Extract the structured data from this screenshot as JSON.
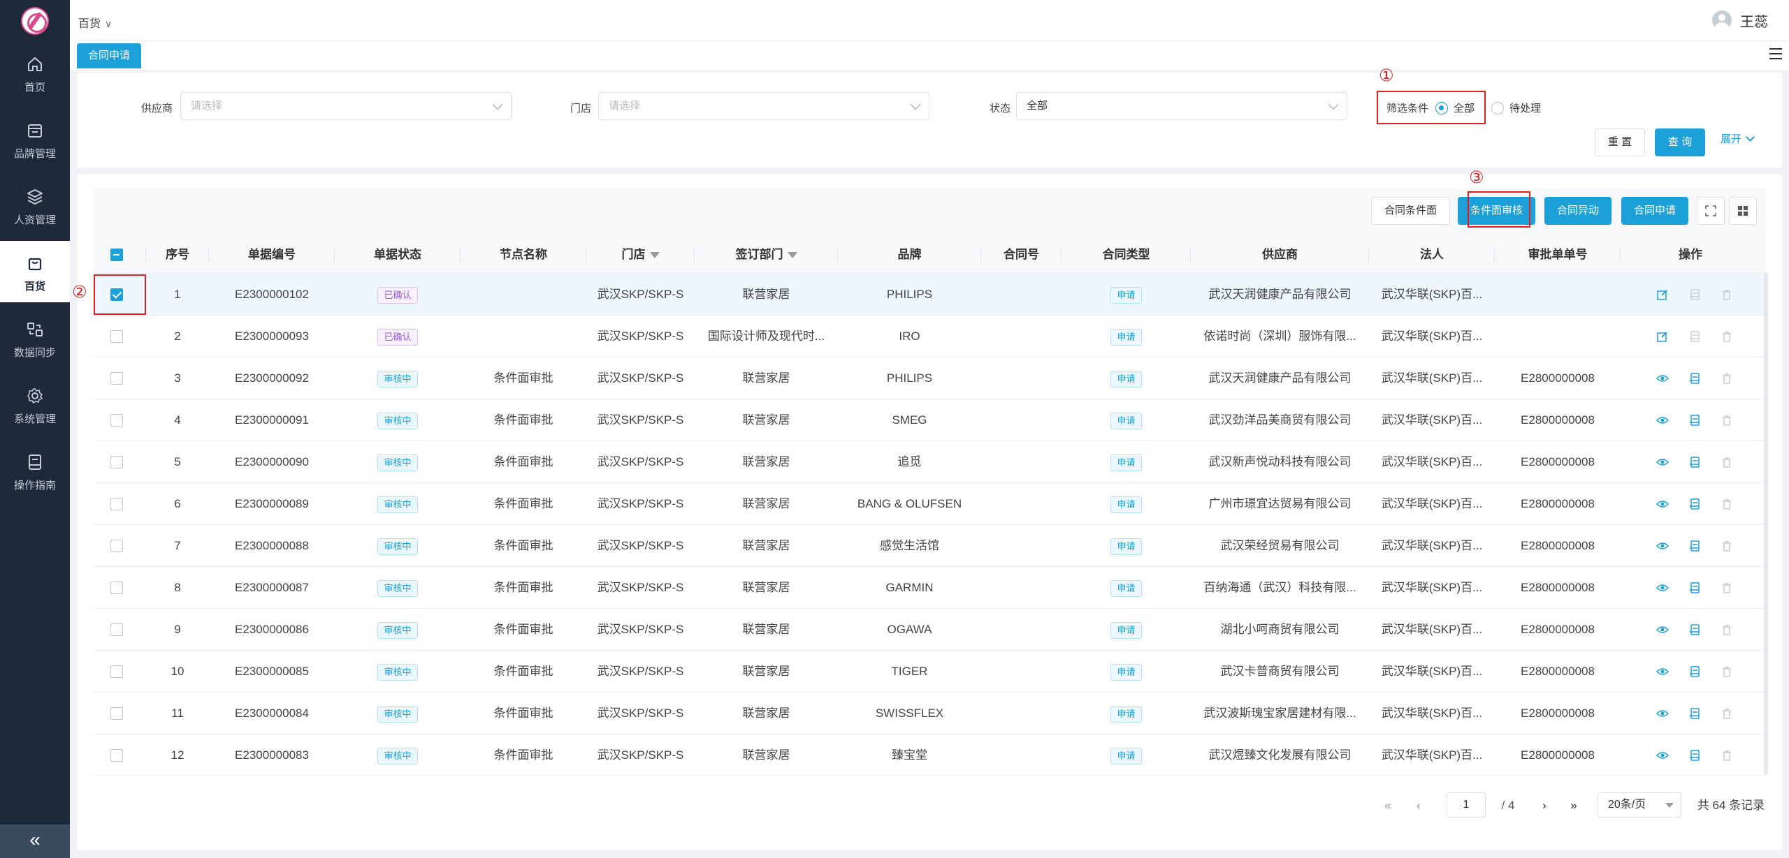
{
  "sidebar": {
    "items": [
      {
        "label": "首页",
        "icon": "home-icon"
      },
      {
        "label": "品牌管理",
        "icon": "brand-icon"
      },
      {
        "label": "人资管理",
        "icon": "layers-icon"
      },
      {
        "label": "百货",
        "icon": "store-bag-icon"
      },
      {
        "label": "数据同步",
        "icon": "sync-icon"
      },
      {
        "label": "系统管理",
        "icon": "settings-icon"
      },
      {
        "label": "操作指南",
        "icon": "guide-icon"
      }
    ],
    "active_index": 3,
    "collapse_label": "«"
  },
  "header": {
    "breadcrumb": "百货",
    "user_name": "王蕊"
  },
  "tabs": [
    {
      "label": "合同申请"
    }
  ],
  "filters": {
    "supplier": {
      "label": "供应商",
      "placeholder": "请选择"
    },
    "store": {
      "label": "门店",
      "placeholder": "请选择"
    },
    "status": {
      "label": "状态",
      "value": "全部"
    },
    "condition": {
      "label": "筛选条件",
      "options": [
        "全部",
        "待处理"
      ],
      "selected": "全部"
    },
    "reset_label": "重 置",
    "query_label": "查 询",
    "expand_label": "展开"
  },
  "annotations": {
    "a1": "①",
    "a2": "②",
    "a3": "③"
  },
  "toolbar": {
    "btn_condition_form": "合同条件面",
    "btn_condition_review": "条件面审核",
    "btn_contract_change": "合同异动",
    "btn_contract_apply": "合同申请"
  },
  "table": {
    "columns": [
      "序号",
      "单据编号",
      "单据状态",
      "节点名称",
      "门店",
      "签订部门",
      "品牌",
      "合同号",
      "合同类型",
      "供应商",
      "法人",
      "审批单单号",
      "操作"
    ],
    "rows": [
      {
        "no": "1",
        "doc": "E2300000102",
        "status": "已确认",
        "status_color": "purple",
        "node": "",
        "store": "武汉SKP/SKP-S",
        "dept": "联营家居",
        "brand": "PHILIPS",
        "contract": "",
        "type": "申请",
        "supplier": "武汉天润健康产品有限公司",
        "legal": "武汉华联(SKP)百...",
        "approval": "",
        "checked": true,
        "mode": "edit"
      },
      {
        "no": "2",
        "doc": "E2300000093",
        "status": "已确认",
        "status_color": "purple",
        "node": "",
        "store": "武汉SKP/SKP-S",
        "dept": "国际设计师及现代时...",
        "brand": "IRO",
        "contract": "",
        "type": "申请",
        "supplier": "依诺时尚（深圳）服饰有限...",
        "legal": "武汉华联(SKP)百...",
        "approval": "",
        "checked": false,
        "mode": "edit"
      },
      {
        "no": "3",
        "doc": "E2300000092",
        "status": "审核中",
        "status_color": "blue",
        "node": "条件面审批",
        "store": "武汉SKP/SKP-S",
        "dept": "联营家居",
        "brand": "PHILIPS",
        "contract": "",
        "type": "申请",
        "supplier": "武汉天润健康产品有限公司",
        "legal": "武汉华联(SKP)百...",
        "approval": "E2800000008",
        "checked": false,
        "mode": "view"
      },
      {
        "no": "4",
        "doc": "E2300000091",
        "status": "审核中",
        "status_color": "blue",
        "node": "条件面审批",
        "store": "武汉SKP/SKP-S",
        "dept": "联营家居",
        "brand": "SMEG",
        "contract": "",
        "type": "申请",
        "supplier": "武汉劲洋品美商贸有限公司",
        "legal": "武汉华联(SKP)百...",
        "approval": "E2800000008",
        "checked": false,
        "mode": "view"
      },
      {
        "no": "5",
        "doc": "E2300000090",
        "status": "审核中",
        "status_color": "blue",
        "node": "条件面审批",
        "store": "武汉SKP/SKP-S",
        "dept": "联营家居",
        "brand": "追觅",
        "contract": "",
        "type": "申请",
        "supplier": "武汉新声悦动科技有限公司",
        "legal": "武汉华联(SKP)百...",
        "approval": "E2800000008",
        "checked": false,
        "mode": "view"
      },
      {
        "no": "6",
        "doc": "E2300000089",
        "status": "审核中",
        "status_color": "blue",
        "node": "条件面审批",
        "store": "武汉SKP/SKP-S",
        "dept": "联营家居",
        "brand": "BANG & OLUFSEN",
        "contract": "",
        "type": "申请",
        "supplier": "广州市璟宜达贸易有限公司",
        "legal": "武汉华联(SKP)百...",
        "approval": "E2800000008",
        "checked": false,
        "mode": "view"
      },
      {
        "no": "7",
        "doc": "E2300000088",
        "status": "审核中",
        "status_color": "blue",
        "node": "条件面审批",
        "store": "武汉SKP/SKP-S",
        "dept": "联营家居",
        "brand": "感觉生活馆",
        "contract": "",
        "type": "申请",
        "supplier": "武汉荣经贸易有限公司",
        "legal": "武汉华联(SKP)百...",
        "approval": "E2800000008",
        "checked": false,
        "mode": "view"
      },
      {
        "no": "8",
        "doc": "E2300000087",
        "status": "审核中",
        "status_color": "blue",
        "node": "条件面审批",
        "store": "武汉SKP/SKP-S",
        "dept": "联营家居",
        "brand": "GARMIN",
        "contract": "",
        "type": "申请",
        "supplier": "百纳海通（武汉）科技有限...",
        "legal": "武汉华联(SKP)百...",
        "approval": "E2800000008",
        "checked": false,
        "mode": "view"
      },
      {
        "no": "9",
        "doc": "E2300000086",
        "status": "审核中",
        "status_color": "blue",
        "node": "条件面审批",
        "store": "武汉SKP/SKP-S",
        "dept": "联营家居",
        "brand": "OGAWA",
        "contract": "",
        "type": "申请",
        "supplier": "湖北小呵商贸有限公司",
        "legal": "武汉华联(SKP)百...",
        "approval": "E2800000008",
        "checked": false,
        "mode": "view"
      },
      {
        "no": "10",
        "doc": "E2300000085",
        "status": "审核中",
        "status_color": "blue",
        "node": "条件面审批",
        "store": "武汉SKP/SKP-S",
        "dept": "联营家居",
        "brand": "TIGER",
        "contract": "",
        "type": "申请",
        "supplier": "武汉卡普商贸有限公司",
        "legal": "武汉华联(SKP)百...",
        "approval": "E2800000008",
        "checked": false,
        "mode": "view"
      },
      {
        "no": "11",
        "doc": "E2300000084",
        "status": "审核中",
        "status_color": "blue",
        "node": "条件面审批",
        "store": "武汉SKP/SKP-S",
        "dept": "联营家居",
        "brand": "SWISSFLEX",
        "contract": "",
        "type": "申请",
        "supplier": "武汉波斯瑰宝家居建材有限...",
        "legal": "武汉华联(SKP)百...",
        "approval": "E2800000008",
        "checked": false,
        "mode": "view"
      },
      {
        "no": "12",
        "doc": "E2300000083",
        "status": "审核中",
        "status_color": "blue",
        "node": "条件面审批",
        "store": "武汉SKP/SKP-S",
        "dept": "联营家居",
        "brand": "臻宝堂",
        "contract": "",
        "type": "申请",
        "supplier": "武汉煜臻文化发展有限公司",
        "legal": "武汉华联(SKP)百...",
        "approval": "E2800000008",
        "checked": false,
        "mode": "view"
      }
    ]
  },
  "pagination": {
    "current_page": "1",
    "total_pages": "/ 4",
    "page_size": "20条/页",
    "total_text": "共 64 条记录"
  },
  "colors": {
    "primary": "#1ba0d8",
    "sidebar": "#1e2a3a",
    "annotation": "#e02020"
  }
}
